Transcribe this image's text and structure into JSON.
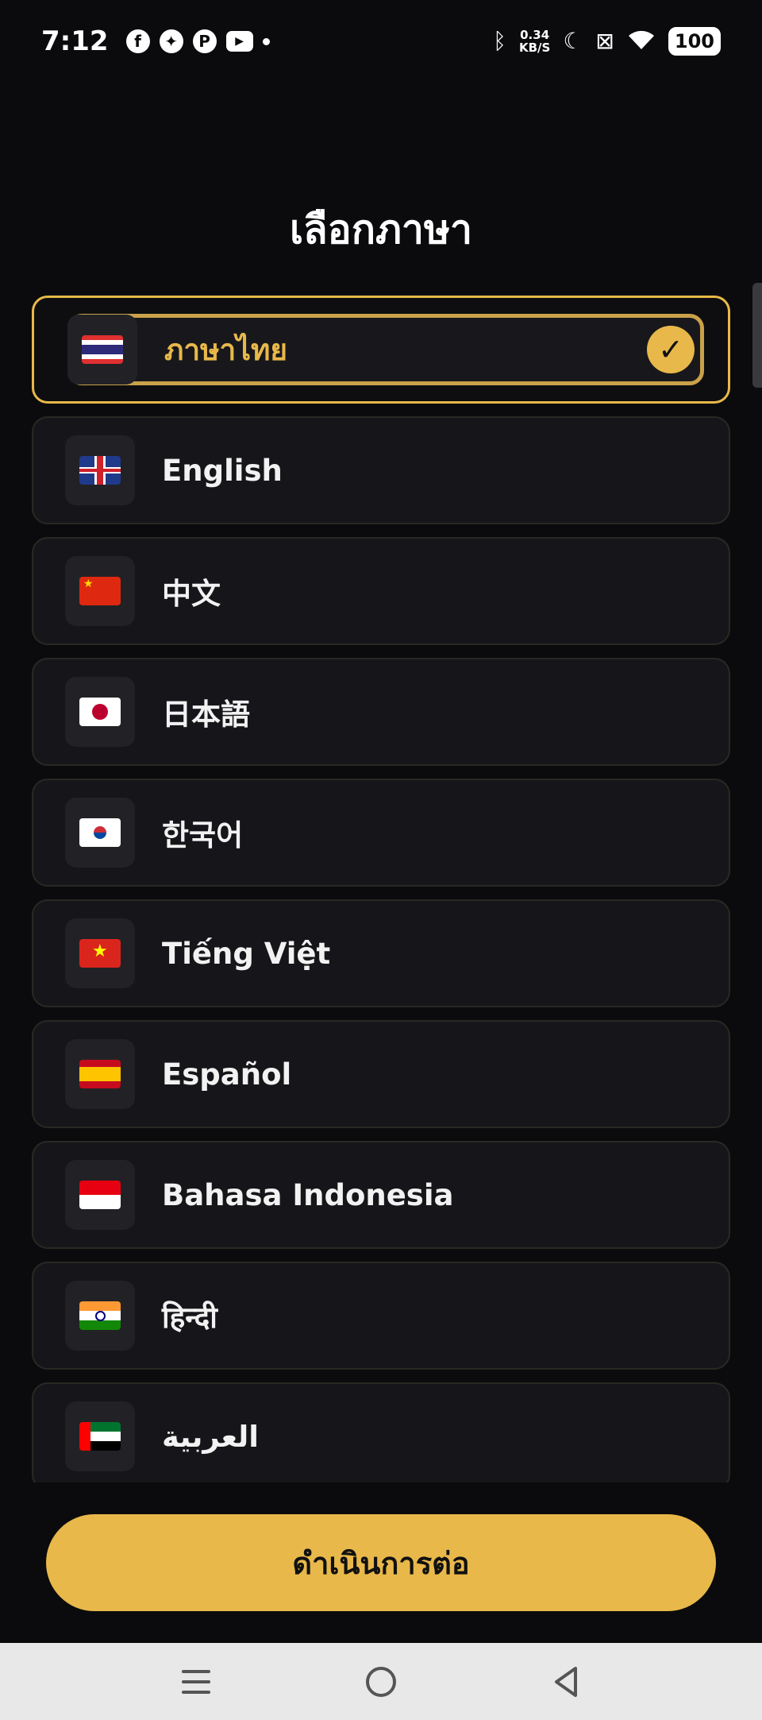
{
  "status_bar": {
    "time": "7:12",
    "apps": [
      "facebook-icon",
      "messenger-icon",
      "pantip-icon",
      "youtube-icon"
    ],
    "net_speed_value": "0.34",
    "net_speed_unit": "KB/S",
    "battery": "100"
  },
  "title": "เลือกภาษา",
  "languages": [
    {
      "label": "ภาษาไทย",
      "flag": "th",
      "selected": true
    },
    {
      "label": "English",
      "flag": "gb",
      "selected": false
    },
    {
      "label": "中文",
      "flag": "cn",
      "selected": false
    },
    {
      "label": "日本語",
      "flag": "jp",
      "selected": false
    },
    {
      "label": "한국어",
      "flag": "kr",
      "selected": false
    },
    {
      "label": "Tiếng Việt",
      "flag": "vn",
      "selected": false
    },
    {
      "label": "Español",
      "flag": "es",
      "selected": false
    },
    {
      "label": "Bahasa Indonesia",
      "flag": "id",
      "selected": false
    },
    {
      "label": "हिन्दी",
      "flag": "in",
      "selected": false
    },
    {
      "label": "العربية",
      "flag": "ae",
      "selected": false
    }
  ],
  "continue_label": "ดำเนินการต่อ",
  "colors": {
    "accent": "#e8b84a",
    "background": "#0b0b0d",
    "card": "#16161a"
  }
}
